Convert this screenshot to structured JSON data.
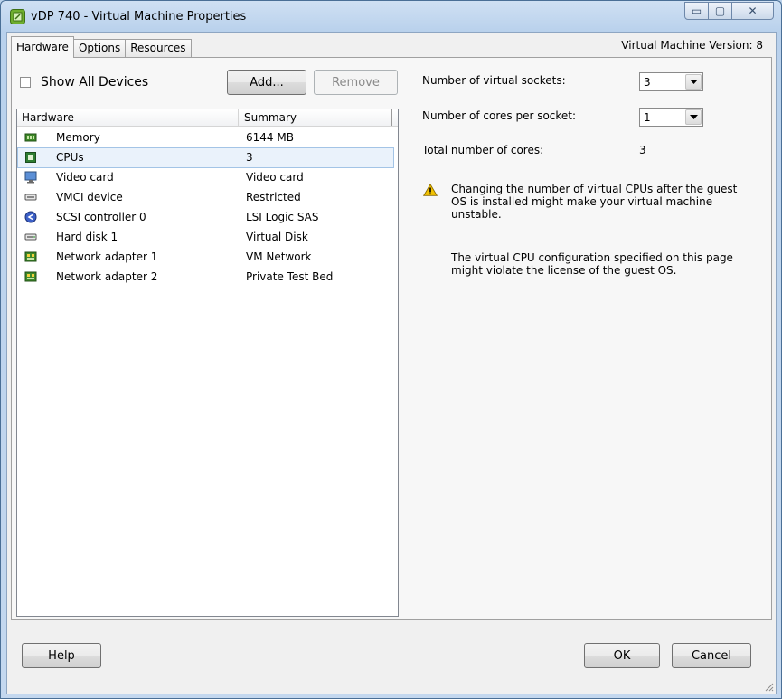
{
  "window": {
    "title": "vDP 740 - Virtual Machine Properties",
    "minimize_glyph": "▭",
    "maximize_glyph": "▢",
    "close_glyph": "✕"
  },
  "tabs": [
    {
      "label": "Hardware",
      "active": true
    },
    {
      "label": "Options",
      "active": false
    },
    {
      "label": "Resources",
      "active": false
    }
  ],
  "vm_version": "Virtual Machine Version: 8",
  "show_all_devices": {
    "label": "Show All Devices",
    "checked": false
  },
  "buttons": {
    "add": "Add...",
    "remove": "Remove",
    "help": "Help",
    "ok": "OK",
    "cancel": "Cancel"
  },
  "hardware_list": {
    "columns": [
      "Hardware",
      "Summary"
    ],
    "rows": [
      {
        "name": "Memory",
        "summary": "6144 MB",
        "icon": "memory-icon",
        "selected": false
      },
      {
        "name": "CPUs",
        "summary": "3",
        "icon": "cpu-icon",
        "selected": true
      },
      {
        "name": "Video card",
        "summary": "Video card",
        "icon": "monitor-icon",
        "selected": false
      },
      {
        "name": "VMCI device",
        "summary": "Restricted",
        "icon": "device-icon",
        "selected": false
      },
      {
        "name": "SCSI controller 0",
        "summary": "LSI Logic SAS",
        "icon": "scsi-icon",
        "selected": false
      },
      {
        "name": "Hard disk 1",
        "summary": "Virtual Disk",
        "icon": "disk-icon",
        "selected": false
      },
      {
        "name": "Network adapter 1",
        "summary": "VM Network",
        "icon": "network-icon",
        "selected": false
      },
      {
        "name": "Network adapter 2",
        "summary": "Private Test Bed",
        "icon": "network-icon",
        "selected": false
      }
    ]
  },
  "cpu_settings": {
    "sockets_label": "Number of virtual sockets:",
    "sockets_value": "3",
    "cores_label": "Number of cores per socket:",
    "cores_value": "1",
    "total_label": "Total number of cores:",
    "total_value": "3",
    "warning_lines": [
      "Changing the number of virtual CPUs after the guest",
      "OS is installed might make your virtual machine",
      "unstable."
    ],
    "license_lines": [
      "The virtual CPU configuration specified on this page",
      "might violate the license of the guest OS."
    ]
  },
  "colors": {
    "selection": "#eaf2fb",
    "selection_border": "#a3c4e6",
    "warning": "#f2c200"
  }
}
